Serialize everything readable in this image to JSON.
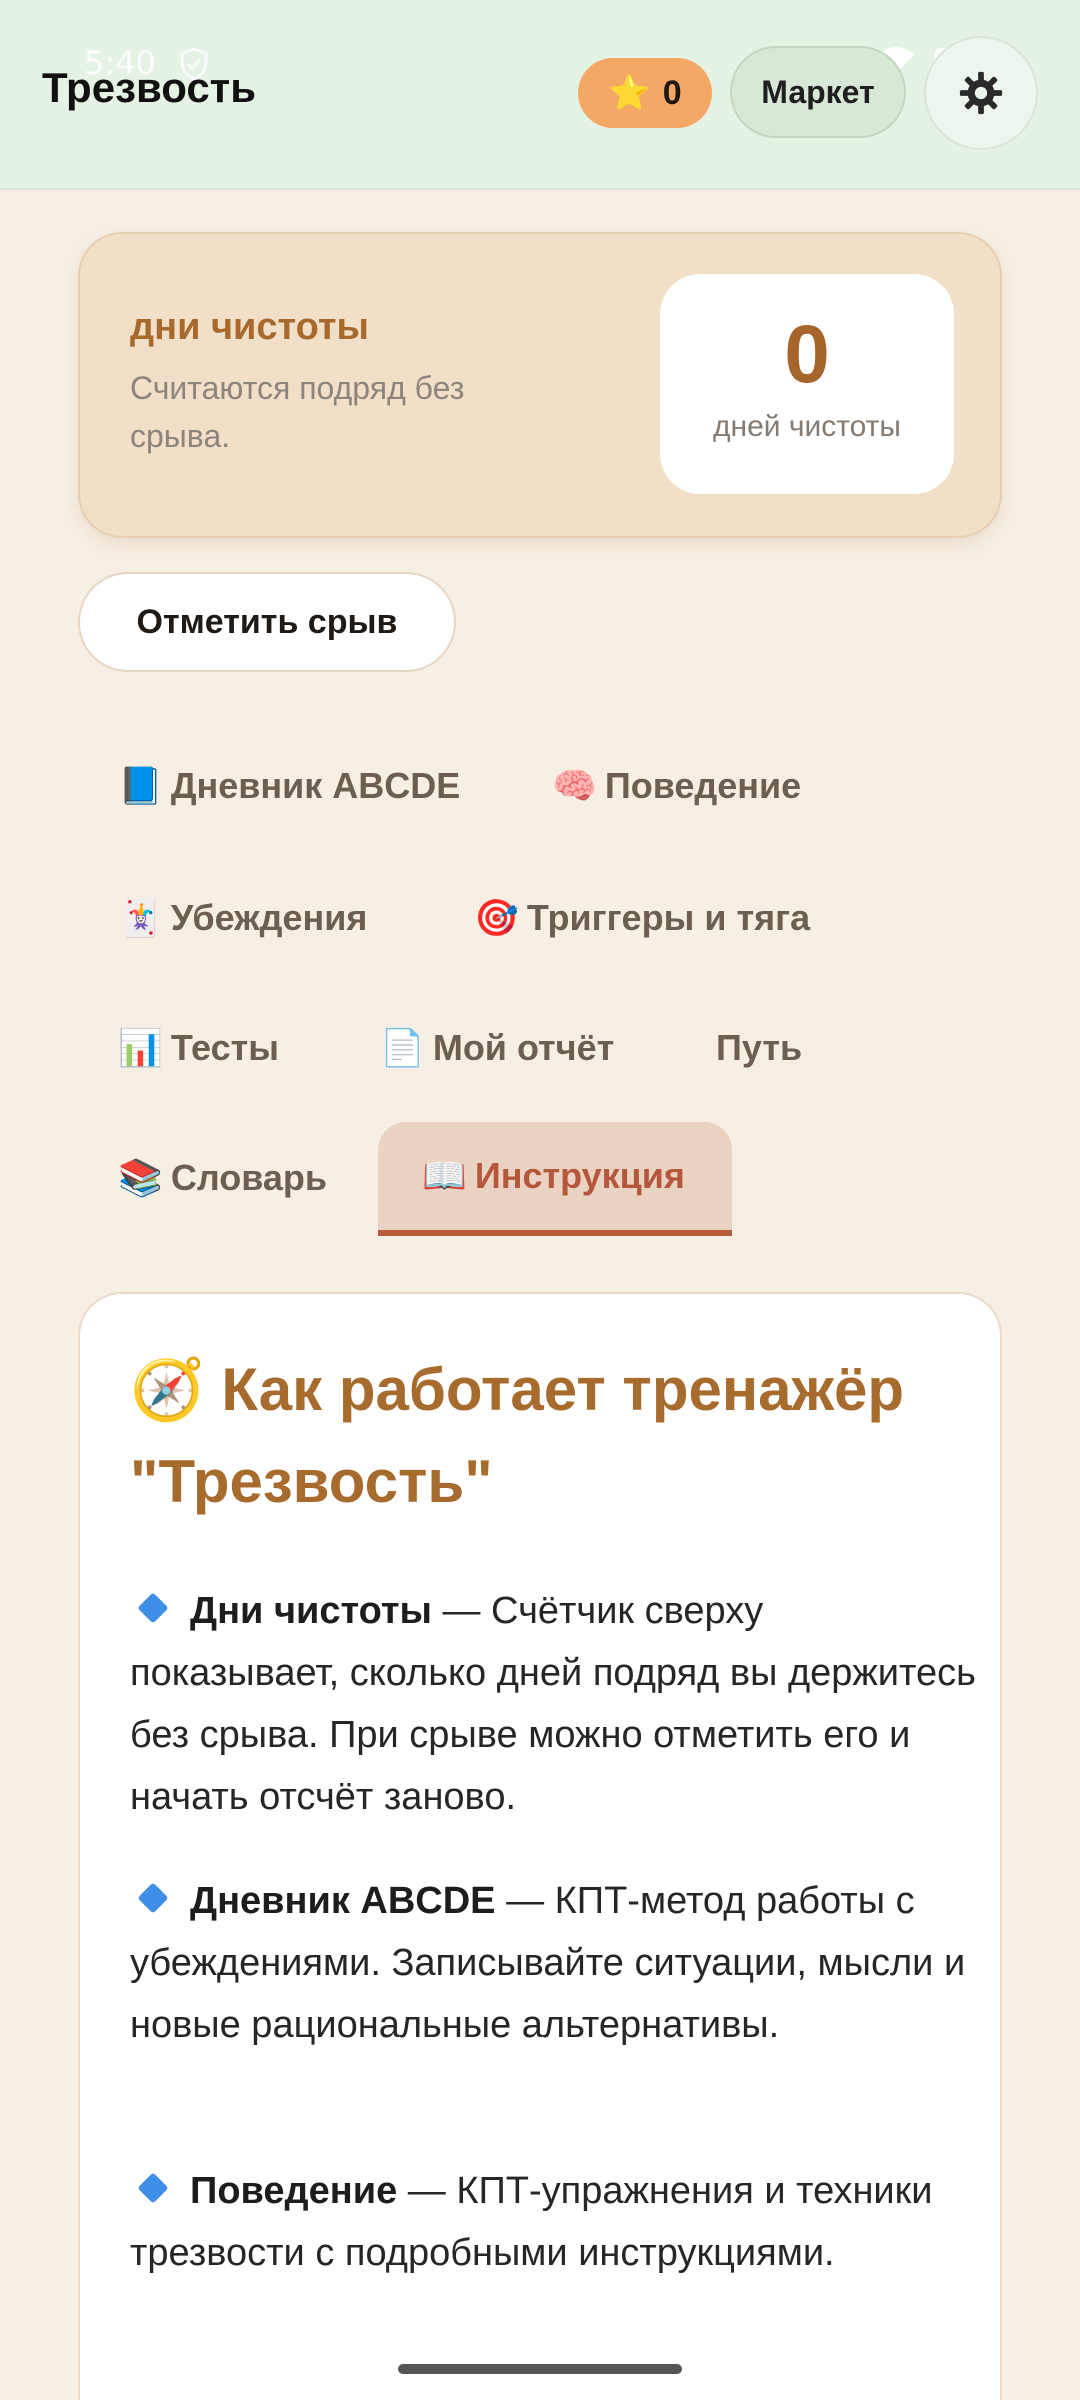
{
  "status_bar": {
    "time": "5:40"
  },
  "header": {
    "title": "Трезвость",
    "points": {
      "icon": "star-icon",
      "glyph": "⭐",
      "value": "0"
    },
    "market_label": "Маркет",
    "settings_icon": "gear-icon"
  },
  "days_card": {
    "title": "дни чистоты",
    "subtitle": "Считаются подряд без срыва.",
    "count": "0",
    "count_caption": "дней чистоты"
  },
  "relapse_button": {
    "label": "Отметить срыв"
  },
  "tabs": [
    {
      "icon": "📘",
      "label": "Дневник ABCDE",
      "active": false
    },
    {
      "icon": "🧠",
      "label": "Поведение",
      "active": false
    },
    {
      "icon": "🃏",
      "label": "Убеждения",
      "active": false
    },
    {
      "icon": "🎯",
      "label": "Триггеры и тяга",
      "active": false
    },
    {
      "icon": "📊",
      "label": "Тесты",
      "active": false
    },
    {
      "icon": "📄",
      "label": "Мой отчёт",
      "active": false
    },
    {
      "icon": "",
      "label": "Путь",
      "active": false
    },
    {
      "icon": "📚",
      "label": "Словарь",
      "active": false
    },
    {
      "icon": "📖",
      "label": "Инструкция",
      "active": true
    }
  ],
  "instructions": {
    "heading_icon": "🧭",
    "heading": "Как работает тренажёр \"Трезвость\"",
    "items": [
      {
        "term": "Дни чистоты",
        "text": " — Счётчик сверху показывает, сколько дней подряд вы держитесь без срыва. При срыве можно отметить его и начать отсчёт заново."
      },
      {
        "term": "Дневник ABCDE",
        "text": " — КПТ-метод работы с убеждениями. Записывайте ситуации, мысли и новые рациональные альтернативы."
      },
      {
        "term": "Поведение",
        "text": " — КПТ-упражнения и техники трезвости с подробными инструкциями."
      }
    ]
  },
  "colors": {
    "header_bg": "#e5f3e5",
    "page_bg": "#f7efe4",
    "accent_brown": "#a86b2e",
    "points_pill": "#f4a865",
    "active_tab_bg": "#ead3c3",
    "active_tab_text": "#b4573a"
  }
}
